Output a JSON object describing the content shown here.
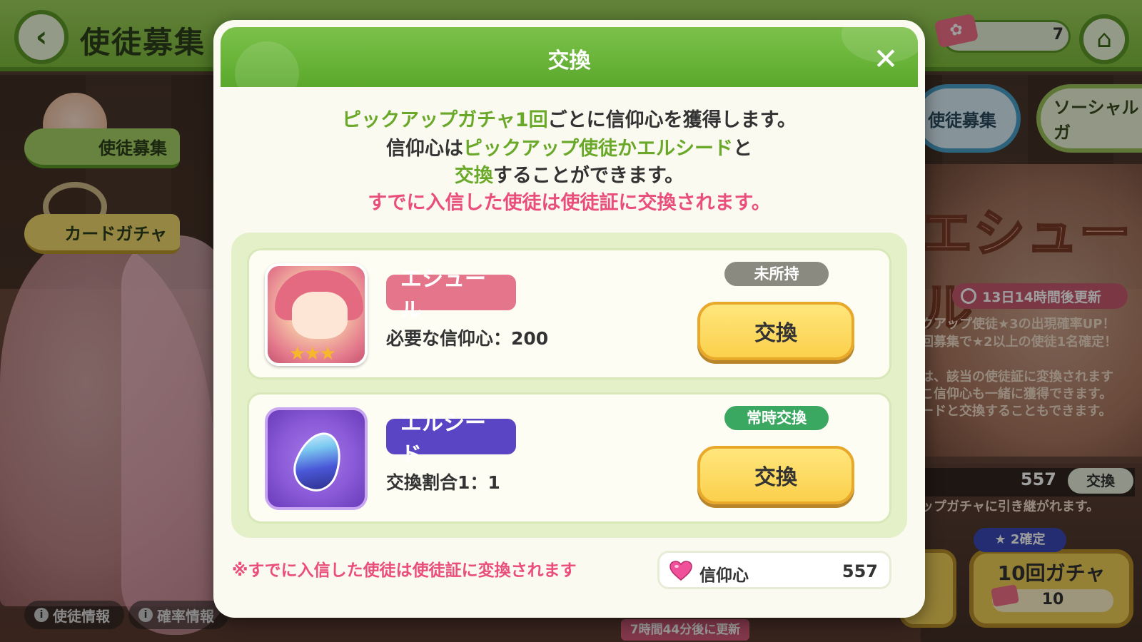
{
  "header": {
    "back_icon": "chevron-left-icon",
    "page_title": "使徒募集",
    "ticket_count": "7",
    "home_icon": "home-icon"
  },
  "sidebar": {
    "items": [
      {
        "label": "使徒募集"
      },
      {
        "label": "カードガチャ"
      }
    ]
  },
  "bottom_links": [
    {
      "label": "使徒情報"
    },
    {
      "label": "確率情報"
    }
  ],
  "background_panel": {
    "tab_recruit": "使徒募集",
    "tab_social": "ソーシャルガ",
    "banner_title": "エシュール",
    "timer": "13日14時間後更新",
    "line1": "クアップ使徒★3の出現確率UP！",
    "line2": "回募集で★2以上の使徒1名確定！",
    "line3": "は、該当の使徒証に変換されます",
    "line4": "こ信仰心も一緒に獲得できます。",
    "line5": "ードと交換することもできます。",
    "faith_value": "557",
    "exchange_label": "交換",
    "carry_over": "ップガチャに引き継がれます。",
    "guarantee_badge": "★ 2確定",
    "gacha10_label": "10回ガチャ",
    "gacha10_cost": "10",
    "update_notice": "7時間44分後に更新"
  },
  "modal": {
    "title": "交換",
    "close_icon": "close-icon",
    "desc": {
      "line1_green": "ピックアップガチャ1回",
      "line1_rest": "ごとに信仰心を獲得します。",
      "line2_start": "信仰心は",
      "line2_green": "ピックアップ使徒かエルシード",
      "line2_end": "と",
      "line3_green": "交換",
      "line3_rest": "することができます。",
      "line4_pink": "すでに入信した使徒は使徒証に交換されます。"
    },
    "items": [
      {
        "name": "エシュール",
        "subtext": "必要な信仰心：200",
        "status": "未所持",
        "button": "交換",
        "stars": "★★★"
      },
      {
        "name": "エルシード",
        "subtext": "交換割合1：1",
        "status": "常時交換",
        "button": "交換"
      }
    ],
    "footnote": "※すでに入信した使徒は使徒証に変換されます",
    "faith_label": "信仰心",
    "faith_value": "557"
  },
  "colors": {
    "header_green": "#5aa82c",
    "accent_green": "#6aa82a",
    "accent_pink": "#ea4e7a",
    "button_yellow": "#fbd04c",
    "pill_pink": "#e4758a",
    "pill_purple": "#5a46c4",
    "status_gray": "#8a8a80",
    "status_green": "#3aa860"
  }
}
